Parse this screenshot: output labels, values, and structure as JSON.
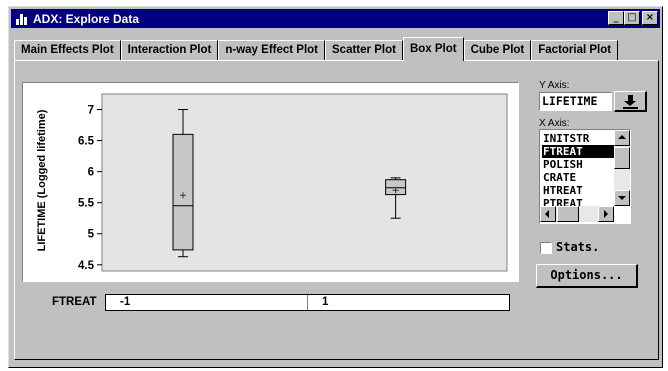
{
  "window": {
    "title": "ADX: Explore Data",
    "controls": {
      "minimize": "_",
      "maximize": "□",
      "close": "×"
    }
  },
  "tabs": [
    {
      "label": "Main Effects Plot",
      "active": false
    },
    {
      "label": "Interaction Plot",
      "active": false
    },
    {
      "label": "n-way Effect Plot",
      "active": false
    },
    {
      "label": "Scatter Plot",
      "active": false
    },
    {
      "label": "Box Plot",
      "active": true
    },
    {
      "label": "Cube Plot",
      "active": false
    },
    {
      "label": "Factorial Plot",
      "active": false
    }
  ],
  "y_axis": {
    "caption": "Y Axis:",
    "value": "LIFETIME",
    "button_icon": "down-arrow-icon"
  },
  "x_axis": {
    "caption": "X Axis:",
    "options": [
      "INITSTR",
      "FTREAT",
      "POLISH",
      "CRATE",
      "HTREAT",
      "PTREAT"
    ],
    "selected": "FTREAT"
  },
  "stats": {
    "label": "Stats.",
    "checked": false
  },
  "options_button": {
    "label": "Options..."
  },
  "factor": {
    "label": "FTREAT",
    "levels": [
      "-1",
      "1"
    ]
  },
  "chart_data": {
    "type": "box",
    "ylabel": "LIFETIME (Logged lifetime)",
    "yticks": [
      "7",
      "6.5",
      "6",
      "5.5",
      "5",
      "4.5"
    ],
    "ylim": [
      4.4,
      7.25
    ],
    "categories": [
      "-1",
      "1"
    ],
    "boxes": [
      {
        "category": "-1",
        "min": 4.63,
        "q1": 4.74,
        "median": 5.45,
        "mean": 5.62,
        "q3": 6.6,
        "max": 7.0
      },
      {
        "category": "1",
        "min": 5.25,
        "q1": 5.63,
        "median": 5.74,
        "mean": 5.7,
        "q3": 5.87,
        "max": 5.9
      }
    ],
    "colors": {
      "background": "#e4e4e4",
      "box_fill": "#c8c8c8",
      "line": "#000000"
    },
    "grid": false
  }
}
